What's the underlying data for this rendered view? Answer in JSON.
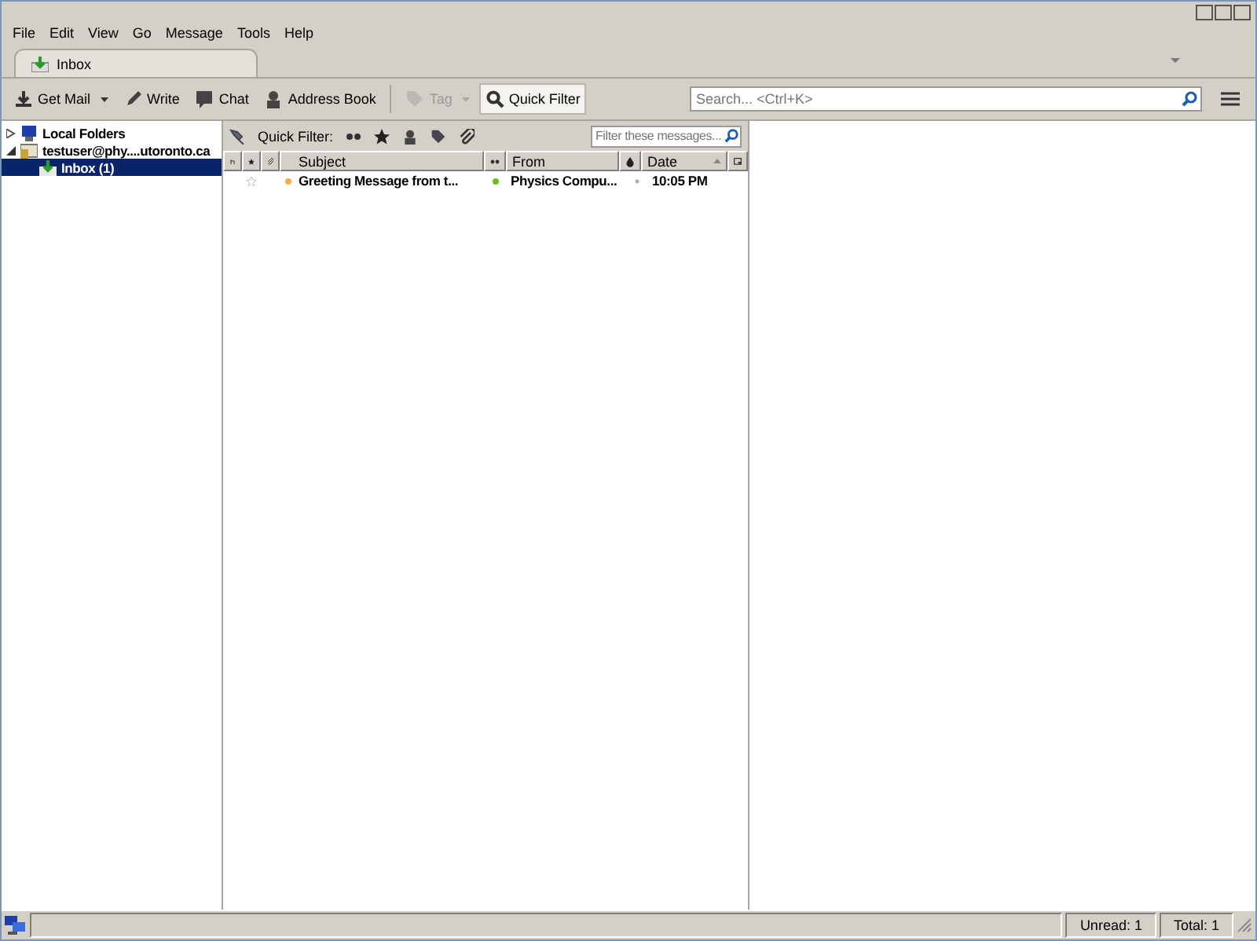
{
  "menu": [
    "File",
    "Edit",
    "View",
    "Go",
    "Message",
    "Tools",
    "Help"
  ],
  "tabs": [
    {
      "label": "Inbox",
      "selected": true
    }
  ],
  "toolbar": [
    {
      "label": "Get Mail",
      "kind": "getmail",
      "dropdown": true,
      "disabled": false,
      "selected": false
    },
    {
      "label": "Write",
      "kind": "write",
      "dropdown": false,
      "disabled": false,
      "selected": false
    },
    {
      "label": "Chat",
      "kind": "chat",
      "dropdown": false,
      "disabled": false,
      "selected": false
    },
    {
      "label": "Address Book",
      "kind": "addressbook",
      "dropdown": false,
      "disabled": false,
      "selected": false
    },
    {
      "label": "Tag",
      "kind": "tag",
      "dropdown": true,
      "disabled": true,
      "selected": false
    },
    {
      "label": "Quick Filter",
      "kind": "quickfilter",
      "dropdown": false,
      "disabled": false,
      "selected": true
    }
  ],
  "search": {
    "placeholder": "Search... <Ctrl+K>"
  },
  "folders": [
    {
      "label": "Local Folders",
      "kind": "local",
      "expanded": false,
      "selected": false
    },
    {
      "label": "testuser@phy....utoronto.ca",
      "kind": "account",
      "expanded": true,
      "selected": false,
      "children": [
        {
          "label": "Inbox (1)",
          "kind": "inbox",
          "selected": true
        }
      ]
    }
  ],
  "quick_filter": {
    "label": "Quick Filter:",
    "placeholder": "Filter these messages..."
  },
  "columns": [
    {
      "kind": "thread"
    },
    {
      "kind": "star"
    },
    {
      "kind": "attach"
    },
    {
      "kind": "text",
      "label": "Subject"
    },
    {
      "kind": "read"
    },
    {
      "kind": "text",
      "label": "From"
    },
    {
      "kind": "junk"
    },
    {
      "kind": "text",
      "label": "Date",
      "sorted": true
    },
    {
      "kind": "picker"
    }
  ],
  "messages": [
    {
      "subject": "Greeting Message from t...",
      "from": "Physics Compu...",
      "date": "10:05 PM",
      "starred": false,
      "unread": true
    }
  ],
  "status_bar": {
    "unread": "Unread: 1",
    "total": "Total: 1"
  }
}
